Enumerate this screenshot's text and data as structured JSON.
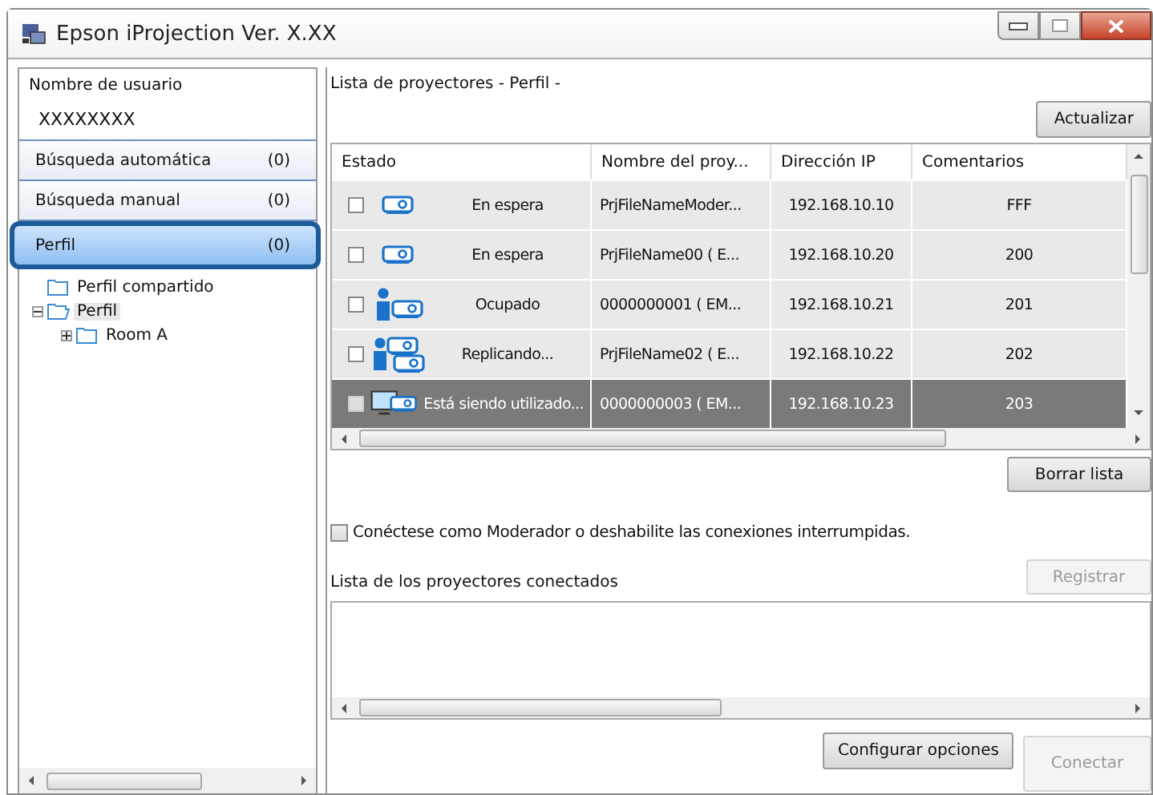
{
  "window": {
    "title": "Epson iProjection Ver. X.XX"
  },
  "sidebar": {
    "user_label": "Nombre de usuario",
    "user_name": "XXXXXXXX",
    "items": [
      {
        "label": "Búsqueda automática",
        "count": "(0)",
        "selected": false
      },
      {
        "label": "Búsqueda manual",
        "count": "(0)",
        "selected": false
      },
      {
        "label": "Perfil",
        "count": "(0)",
        "selected": true
      }
    ],
    "tree": [
      {
        "label": "Perfil compartido",
        "selected": false
      },
      {
        "label": "Perfil",
        "selected": true,
        "expanded": true,
        "children": [
          {
            "label": "Room A",
            "selected": false,
            "expanded": false
          }
        ]
      }
    ]
  },
  "projector_list": {
    "title": "Lista de proyectores - Perfil -",
    "refresh_button": "Actualizar",
    "columns": [
      "Estado",
      "Nombre del proy...",
      "Dirección IP",
      "Comentarios"
    ],
    "rows": [
      {
        "checked": false,
        "kind": "standby",
        "status": "En espera",
        "name": "PrjFileNameModer...",
        "ip": "192.168.10.10",
        "comment": "FFF",
        "selected": false
      },
      {
        "checked": false,
        "kind": "standby",
        "status": "En espera",
        "name": "PrjFileName00 ( E...",
        "ip": "192.168.10.20",
        "comment": "200",
        "selected": false
      },
      {
        "checked": false,
        "kind": "busy",
        "status": "Ocupado",
        "name": "0000000001 ( EM...",
        "ip": "192.168.10.21",
        "comment": "201",
        "selected": false
      },
      {
        "checked": false,
        "kind": "replicating",
        "status": "Replicando...",
        "name": "PrjFileName02 ( E...",
        "ip": "192.168.10.22",
        "comment": "202",
        "selected": false
      },
      {
        "checked": false,
        "kind": "in_use",
        "status": "Está siendo utilizado...",
        "name": "0000000003 ( EM...",
        "ip": "192.168.10.23",
        "comment": "203",
        "selected": true
      }
    ],
    "clear_button": "Borrar lista"
  },
  "moderator_option": {
    "label": "Conéctese como Moderador o deshabilite las conexiones interrumpidas.",
    "checked": false
  },
  "connected_list": {
    "title": "Lista de los proyectores conectados",
    "register_button": {
      "label": "Registrar",
      "disabled": true
    }
  },
  "footer": {
    "options_button": {
      "label": "Configurar opciones",
      "disabled": false
    },
    "connect_button": {
      "label": "Conectar",
      "disabled": true
    }
  }
}
